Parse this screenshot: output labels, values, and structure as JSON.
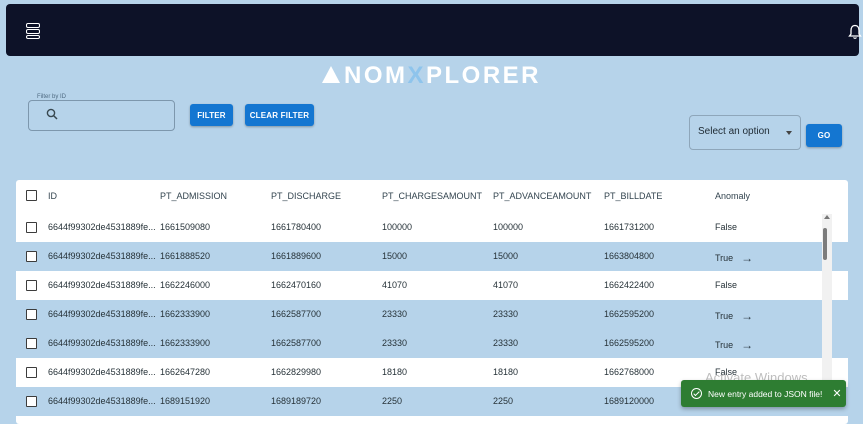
{
  "app": {
    "logo_prefix": "NOM",
    "logo_x": "X",
    "logo_suffix": "PLORER"
  },
  "filter": {
    "legend": "Filter by ID",
    "placeholder": "",
    "value": ""
  },
  "buttons": {
    "filter": "FILTER",
    "clear_filter": "CLEAR FILTER",
    "go": "GO"
  },
  "select": {
    "label": "Select an option"
  },
  "table": {
    "headers": [
      "ID",
      "PT_ADMISSION",
      "PT_DISCHARGE",
      "PT_CHARGESAMOUNT",
      "PT_ADVANCEAMOUNT",
      "PT_BILLDATE",
      "Anomaly"
    ],
    "rows": [
      {
        "id": "6644f99302de4531889fe...",
        "admission": "1661509080",
        "discharge": "1661780400",
        "charges": "100000",
        "advance": "100000",
        "billdate": "1661731200",
        "anomaly": "False",
        "highlight": false
      },
      {
        "id": "6644f99302de4531889fe...",
        "admission": "1661888520",
        "discharge": "1661889600",
        "charges": "15000",
        "advance": "15000",
        "billdate": "1663804800",
        "anomaly": "True",
        "highlight": true
      },
      {
        "id": "6644f99302de4531889fe...",
        "admission": "1662246000",
        "discharge": "1662470160",
        "charges": "41070",
        "advance": "41070",
        "billdate": "1662422400",
        "anomaly": "False",
        "highlight": false
      },
      {
        "id": "6644f99302de4531889fe...",
        "admission": "1662333900",
        "discharge": "1662587700",
        "charges": "23330",
        "advance": "23330",
        "billdate": "1662595200",
        "anomaly": "True",
        "highlight": true
      },
      {
        "id": "6644f99302de4531889fe...",
        "admission": "1662333900",
        "discharge": "1662587700",
        "charges": "23330",
        "advance": "23330",
        "billdate": "1662595200",
        "anomaly": "True",
        "highlight": true
      },
      {
        "id": "6644f99302de4531889fe...",
        "admission": "1662647280",
        "discharge": "1662829980",
        "charges": "18180",
        "advance": "18180",
        "billdate": "1662768000",
        "anomaly": "False",
        "highlight": false
      },
      {
        "id": "6644f99302de4531889fe...",
        "admission": "1689151920",
        "discharge": "1689189720",
        "charges": "2250",
        "advance": "2250",
        "billdate": "1689120000",
        "anomaly": "",
        "highlight": true
      }
    ]
  },
  "watermark": "Activate Windows",
  "toast": {
    "message": "New entry added to JSON file!",
    "close": "✕"
  },
  "colors": {
    "background": "#b6d3ea",
    "topbar": "#0d1228",
    "button": "#1476d1",
    "toast": "#2e7d32"
  }
}
